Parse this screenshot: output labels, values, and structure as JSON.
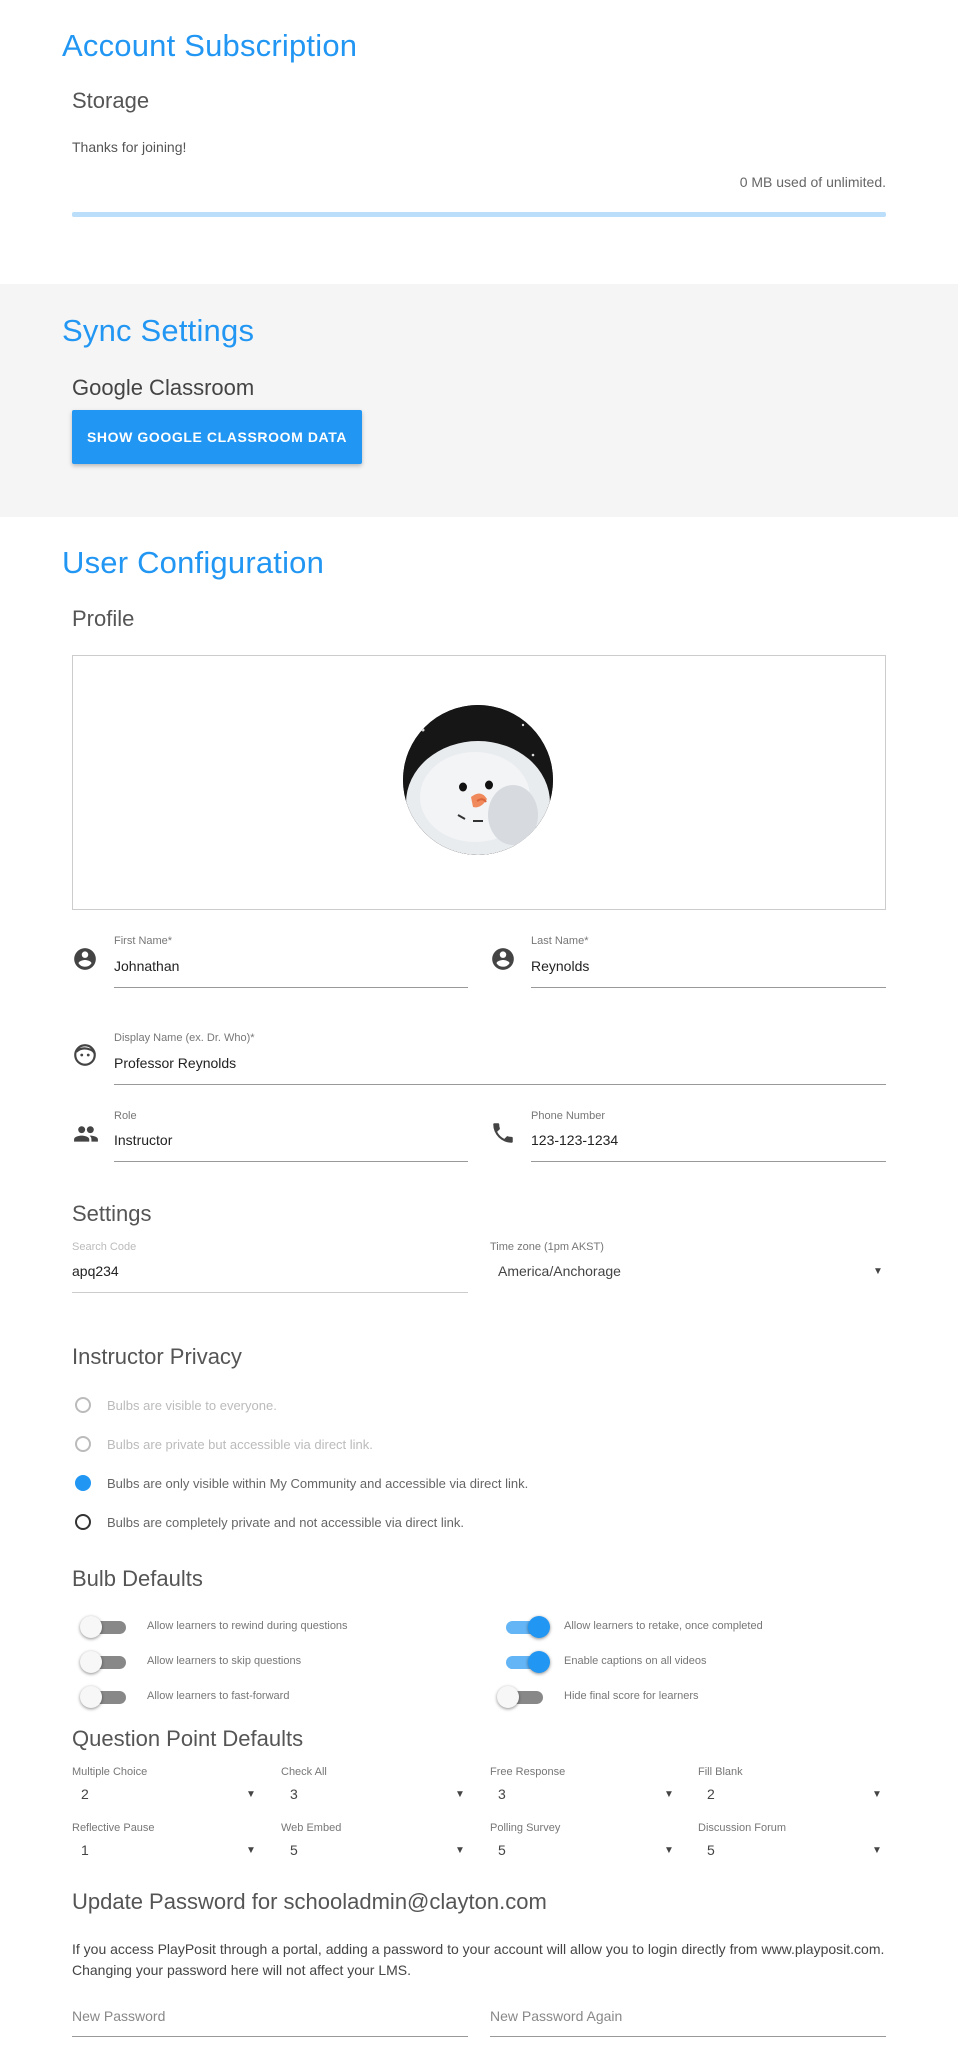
{
  "account": {
    "title": "Account Subscription",
    "storage_heading": "Storage",
    "thanks_text": "Thanks for joining!",
    "usage_text": "0 MB used of unlimited.",
    "usage_progress": 0
  },
  "sync": {
    "title": "Sync Settings",
    "google_heading": "Google Classroom",
    "show_button": "SHOW GOOGLE CLASSROOM DATA"
  },
  "user_config": {
    "title": "User Configuration",
    "profile_heading": "Profile",
    "first_name": {
      "label": "First Name*",
      "value": "Johnathan"
    },
    "last_name": {
      "label": "Last Name*",
      "value": "Reynolds"
    },
    "display_name": {
      "label": "Display Name (ex. Dr. Who)*",
      "value": "Professor Reynolds"
    },
    "role": {
      "label": "Role",
      "value": "Instructor"
    },
    "phone": {
      "label": "Phone Number",
      "value": "123-123-1234"
    }
  },
  "settings": {
    "heading": "Settings",
    "search_code": {
      "label": "Search Code",
      "value": "apq234"
    },
    "timezone": {
      "label": "Time zone (1pm AKST)",
      "value": "America/Anchorage"
    }
  },
  "privacy": {
    "heading": "Instructor Privacy",
    "options": [
      {
        "label": "Bulbs are visible to everyone.",
        "state": "disabled"
      },
      {
        "label": "Bulbs are private but accessible via direct link.",
        "state": "disabled"
      },
      {
        "label": "Bulbs are only visible within My Community and accessible via direct link.",
        "state": "selected"
      },
      {
        "label": "Bulbs are completely private and not accessible via direct link.",
        "state": "unselected"
      }
    ]
  },
  "bulb_defaults": {
    "heading": "Bulb Defaults",
    "toggles": [
      {
        "label": "Allow learners to rewind during questions",
        "on": false
      },
      {
        "label": "Allow learners to skip questions",
        "on": false
      },
      {
        "label": "Allow learners to fast-forward",
        "on": false
      },
      {
        "label": "Allow learners to retake, once completed",
        "on": true
      },
      {
        "label": "Enable captions on all videos",
        "on": true
      },
      {
        "label": "Hide final score for learners",
        "on": false
      }
    ]
  },
  "question_points": {
    "heading": "Question Point Defaults",
    "items": [
      {
        "label": "Multiple Choice",
        "value": "2"
      },
      {
        "label": "Check All",
        "value": "3"
      },
      {
        "label": "Free Response",
        "value": "3"
      },
      {
        "label": "Fill Blank",
        "value": "2"
      },
      {
        "label": "Reflective Pause",
        "value": "1"
      },
      {
        "label": "Web Embed",
        "value": "5"
      },
      {
        "label": "Polling Survey",
        "value": "5"
      },
      {
        "label": "Discussion Forum",
        "value": "5"
      }
    ]
  },
  "password": {
    "heading": "Update Password for schooladmin@clayton.com",
    "info_line1": "If you access PlayPosit through a portal, adding a password to your account will allow you to login directly from www.playposit.com.",
    "info_line2": "Changing your password here will not affect your LMS.",
    "new_placeholder": "New Password",
    "again_placeholder": "New Password Again"
  },
  "colors": {
    "accent": "#2196f3",
    "panel_gray": "#f5f5f5"
  }
}
